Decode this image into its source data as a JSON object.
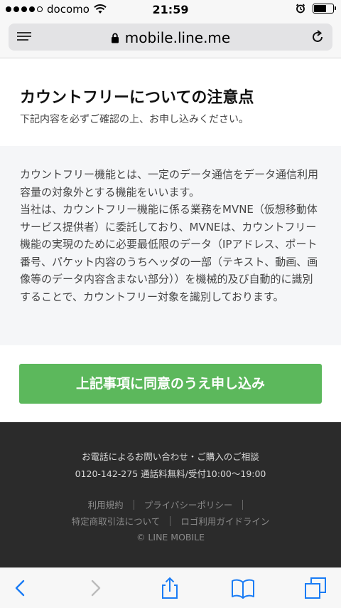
{
  "status_bar": {
    "carrier": "docomo",
    "time": "21:59",
    "signal_bars_filled": 4,
    "signal_bars_total": 5
  },
  "browser": {
    "url": "mobile.line.me"
  },
  "header": {
    "title": "カウントフリーについての注意点",
    "subtitle": "下記内容を必ずご確認の上、お申し込みください。"
  },
  "body": {
    "paragraph_1": "カウントフリー機能とは、一定のデータ通信をデータ通信利用容量の対象外とする機能をいいます。",
    "paragraph_2": "当社は、カウントフリー機能に係る業務をMVNE（仮想移動体サービス提供者）に委託しており、MVNEは、カウントフリー機能の実現のために必要最低限のデータ（IPアドレス、ポート番号、パケット内容のうちヘッダの一部（テキスト、動画、画像等のデータ内容含まない部分））を機械的及び自動的に識別することで、カウントフリー対象を識別しております。"
  },
  "cta": {
    "label": "上記事項に同意のうえ申し込み",
    "color": "#5cb85c"
  },
  "footer": {
    "contact_label": "お電話によるお問い合わせ・ご購入のご相談",
    "tel_line": "0120-142-275 通話料無料/受付10:00～19:00",
    "links": {
      "terms": "利用規約",
      "privacy": "プライバシーポリシー",
      "commerce": "特定商取引法について",
      "logo_guide": "ロゴ利用ガイドライン"
    },
    "copyright": "© LINE MOBILE"
  },
  "toolbar": {
    "icons": [
      "back-icon",
      "forward-icon",
      "share-icon",
      "bookmarks-icon",
      "tabs-icon"
    ],
    "accent": "#1a7cf5"
  }
}
